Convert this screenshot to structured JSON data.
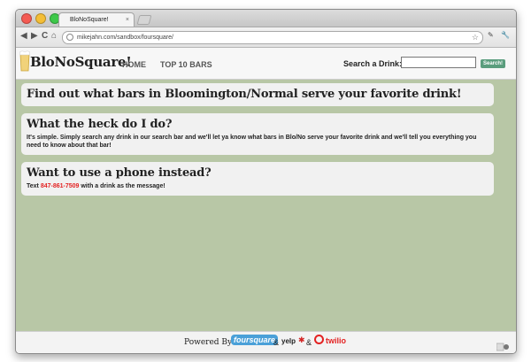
{
  "browser": {
    "tab_title": "BloNoSquare!",
    "tab_close": "×",
    "url": "mikejahn.com/sandbox/foursquare/",
    "nav": {
      "back": "◀",
      "forward": "▶",
      "reload": "C",
      "home": "⌂"
    },
    "star": "☆",
    "tools": {
      "wrench": "🔧",
      "page": "✎"
    }
  },
  "site": {
    "logo": "BloNoSquare!",
    "nav": [
      {
        "label": "HOME"
      },
      {
        "label": "TOP 10 BARS"
      }
    ],
    "search": {
      "label": "Search a Drink:",
      "value": "",
      "button": "Search!"
    }
  },
  "cards": [
    {
      "title": "Find out what bars in Bloomington/Normal serve your favorite drink!"
    },
    {
      "title": "What the heck do I do?",
      "body": "It's simple. Simply search any drink in our search bar and we'll let ya know what bars in Blo/No serve your favorite drink and we'll tell you everything you need to know about that bar!"
    },
    {
      "title": "Want to use a phone instead?",
      "body_pre": "Text ",
      "phone": "847-861-7509",
      "body_post": " with a drink as the message!"
    }
  ],
  "footer": {
    "powered": "Powered By:",
    "foursquare": "foursquare",
    "amp": "&",
    "yelp": "yelp",
    "yelp_burst": "✱",
    "twilio": "twilio"
  },
  "colors": {
    "page_bg": "#b8c7a6",
    "accent_red": "#e32222",
    "search_button": "#5a9d7d"
  }
}
